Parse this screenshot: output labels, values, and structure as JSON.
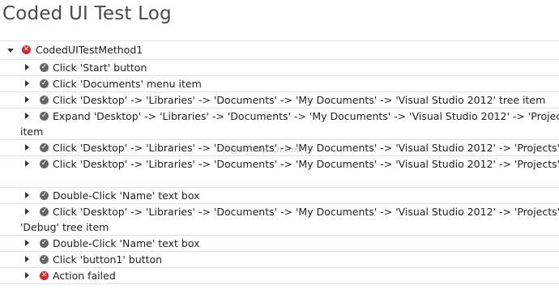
{
  "title": "Coded UI Test Log",
  "root": {
    "label": "CodedUITestMethod1",
    "status": "fail"
  },
  "steps": [
    {
      "line1": "Click 'Start' button",
      "line2": "",
      "status": "pass"
    },
    {
      "line1": "Click 'Documents' menu item",
      "line2": "",
      "status": "pass"
    },
    {
      "line1": "Click 'Desktop' -> 'Libraries' -> 'Documents' -> 'My Documents' -> 'Visual Studio 2012' tree item",
      "line2": "",
      "status": "pass"
    },
    {
      "line1": "Expand 'Desktop' -> 'Libraries' -> 'Documents' -> 'My Documents' -> 'Visual Studio 2012' -> 'Projects' -> 'C",
      "line2": "item",
      "status": "pass"
    },
    {
      "line1": "Click 'Desktop' -> 'Libraries' -> 'Documents' -> 'My Documents' -> 'Visual Studio 2012' -> 'Projects' -> 'C",
      "line2": "",
      "status": "pass"
    },
    {
      "line1": "Click 'Desktop' -> 'Libraries' -> 'Documents' -> 'My Documents' -> 'Visual Studio 2012' -> 'Projects' -> 'C",
      "line2": "",
      "status": "pass"
    },
    {
      "line1": "Double-Click 'Name' text box",
      "line2": "",
      "status": "pass"
    },
    {
      "line1": "Click 'Desktop' -> 'Libraries' -> 'Documents' -> 'My Documents' -> 'Visual Studio 2012' -> 'Projects' -> 'C",
      "line2": "'Debug' tree item",
      "status": "pass"
    },
    {
      "line1": "Double-Click 'Name' text box",
      "line2": "",
      "status": "pass"
    },
    {
      "line1": "Click 'button1' button",
      "line2": "",
      "status": "pass"
    },
    {
      "line1": "Action failed",
      "line2": "",
      "status": "fail"
    }
  ],
  "watermark": "@DevNet.Cn.com",
  "icons": {
    "pass": "check-circle-icon",
    "fail": "x-circle-icon",
    "expanded": "caret-down-icon",
    "collapsed": "caret-right-icon"
  },
  "colors": {
    "pass": "#666666",
    "fail": "#d9262c",
    "divider": "#e2e2e2",
    "title": "#4a4a4a"
  }
}
